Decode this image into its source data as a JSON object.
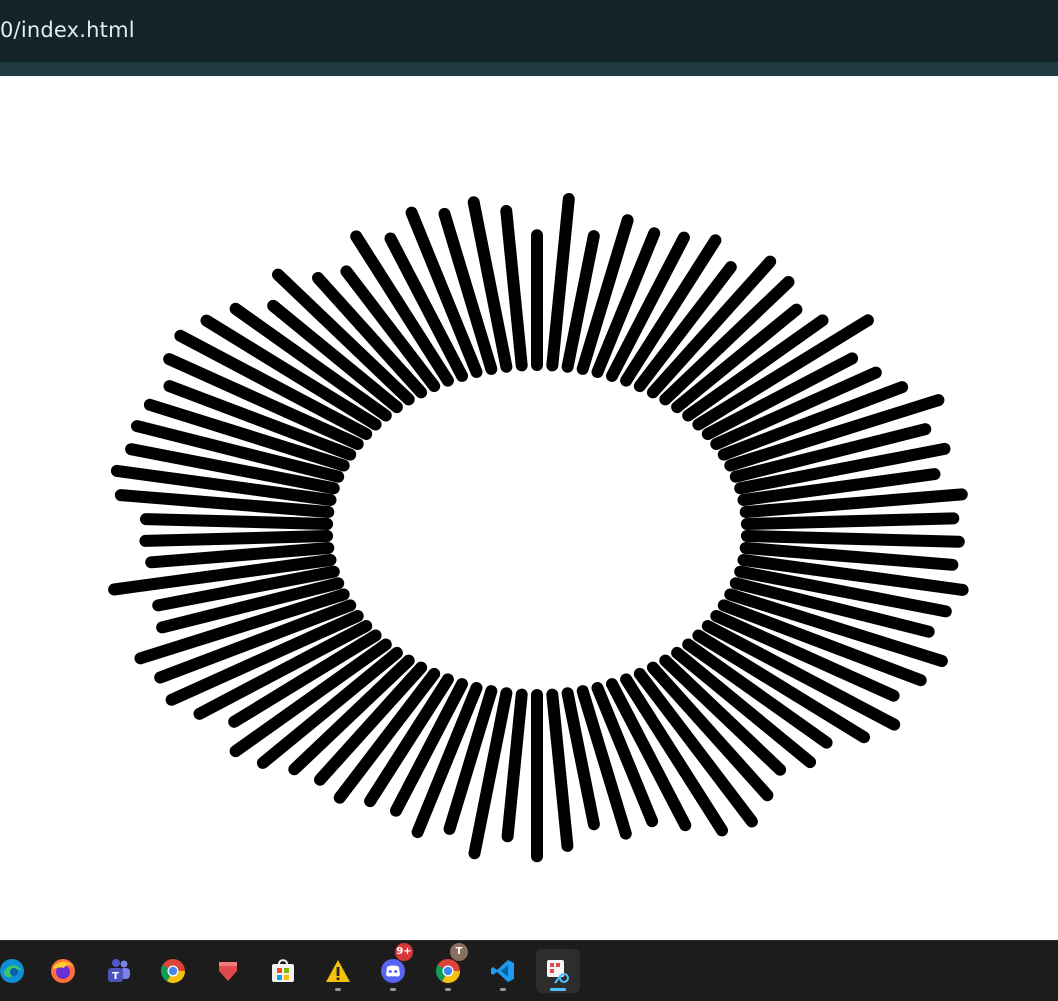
{
  "browser": {
    "url_fragment": "0/index.html"
  },
  "canvas": {
    "description_color": "#000000",
    "background_color": "#ffffff"
  },
  "taskbar": {
    "apps": [
      {
        "name": "edge-icon",
        "badge": ""
      },
      {
        "name": "firefox-icon",
        "badge": ""
      },
      {
        "name": "teams-icon",
        "badge": ""
      },
      {
        "name": "chrome-icon",
        "badge": ""
      },
      {
        "name": "bookmark-app-icon",
        "badge": ""
      },
      {
        "name": "microsoft-store-icon",
        "badge": ""
      },
      {
        "name": "warning-app-icon",
        "badge": ""
      },
      {
        "name": "discord-icon",
        "badge": "9+"
      },
      {
        "name": "chrome-profile-icon",
        "badge": "T"
      },
      {
        "name": "vscode-icon",
        "badge": ""
      },
      {
        "name": "snipping-tool-icon",
        "badge": ""
      }
    ]
  }
}
